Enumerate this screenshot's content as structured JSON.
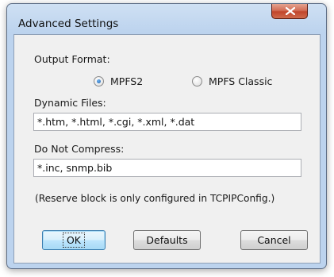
{
  "window": {
    "title": "Advanced Settings"
  },
  "output_format": {
    "label": "Output Format:",
    "options": [
      {
        "label": "MPFS2",
        "selected": true
      },
      {
        "label": "MPFS Classic",
        "selected": false
      }
    ]
  },
  "dynamic_files": {
    "label": "Dynamic Files:",
    "value": "*.htm, *.html, *.cgi, *.xml, *.dat"
  },
  "do_not_compress": {
    "label": "Do Not Compress:",
    "value": "*.inc, snmp.bib"
  },
  "note": "(Reserve block is only configured in TCPIPConfig.)",
  "buttons": {
    "ok": "OK",
    "defaults": "Defaults",
    "cancel": "Cancel"
  },
  "colors": {
    "titlebar": "#bcd3ee",
    "close_button": "#c1452b",
    "client_area": "#f0f0f0",
    "default_button_border": "#3c7fb1"
  },
  "icons": {
    "close": "close-x-icon"
  }
}
